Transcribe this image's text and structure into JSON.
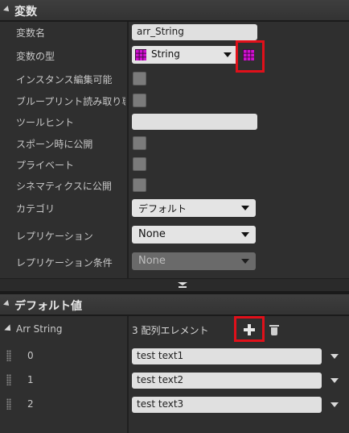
{
  "variables_section": {
    "title": "変数",
    "rows": {
      "name_label": "変数名",
      "name_value": "arr_String",
      "type_label": "変数の型",
      "type_value": "String",
      "instance_editable_label": "インスタンス編集可能",
      "blueprint_readonly_label": "ブループリント読み取り専",
      "tooltip_label": "ツールヒント",
      "tooltip_value": "",
      "expose_on_spawn_label": "スポーン時に公開",
      "private_label": "プライベート",
      "expose_cinematics_label": "シネマティクスに公開",
      "category_label": "カテゴリ",
      "category_value": "デフォルト",
      "replication_label": "レプリケーション",
      "replication_value": "None",
      "replication_condition_label": "レプリケーション条件",
      "replication_condition_value": "None"
    }
  },
  "default_section": {
    "title": "デフォルト値",
    "array_label": "Arr String",
    "array_count_text": "3 配列エレメント",
    "elements": [
      {
        "index": "0",
        "value": "test text1"
      },
      {
        "index": "1",
        "value": "test text2"
      },
      {
        "index": "2",
        "value": "test text3"
      }
    ]
  },
  "icons": {
    "type_pin": "string-array-pin-icon",
    "container_type": "array-container-icon",
    "add": "plus-icon",
    "delete": "trash-icon"
  },
  "colors": {
    "string_pin": "#d010d0",
    "highlight": "#e0101a",
    "panel_bg": "#2f2f2f",
    "header_bg": "#3a3a3a"
  }
}
